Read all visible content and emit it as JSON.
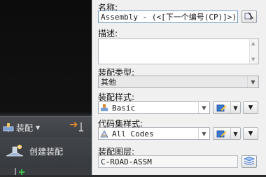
{
  "ribbon": {
    "assembly_menu_label": "装配",
    "create_assembly_label": "创建装配"
  },
  "form": {
    "name_label": "名称:",
    "name_value": "Assembly - (<[下一个编号(CP)]>)",
    "description_label": "描述:",
    "description_value": "",
    "assembly_type_label": "装配类型:",
    "assembly_type_value": "其他",
    "assembly_style_label": "装配样式:",
    "assembly_style_value": "Basic",
    "code_set_style_label": "代码集样式:",
    "code_set_style_value": "All Codes",
    "assembly_layer_label": "装配图层:",
    "assembly_layer_value": "C-ROAD-ASSM"
  },
  "icons": {
    "name_pick": "name-template-icon",
    "style_edit": "edit-style-icon",
    "layer_pick": "layer-select-icon"
  },
  "colors": {
    "panel_bg": "#f0f0f0",
    "ribbon_dark": "#3c3f44",
    "accent_blue": "#2f6fd0"
  }
}
